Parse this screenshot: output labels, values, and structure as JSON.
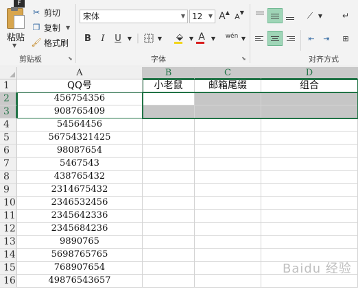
{
  "ribbon": {
    "file_tab": "F",
    "clipboard": {
      "paste_label": "粘贴",
      "cut_label": "剪切",
      "copy_label": "复制",
      "format_painter_label": "格式刷",
      "group_label": "剪贴板"
    },
    "font": {
      "font_name": "宋体",
      "font_size": "12",
      "grow_glyph": "A",
      "shrink_glyph": "A",
      "bold": "B",
      "italic": "I",
      "underline": "U",
      "font_color_glyph": "A",
      "wen_glyph": "wén",
      "fill_color": "#f2d51a",
      "font_color": "#d81e1e",
      "group_label": "字体"
    },
    "alignment": {
      "group_label": "对齐方式"
    }
  },
  "sheet": {
    "column_headers": [
      "A",
      "B",
      "C",
      "D"
    ],
    "row_numbers": [
      "1",
      "2",
      "3",
      "4",
      "5",
      "6",
      "7",
      "8",
      "9",
      "10",
      "11",
      "12",
      "13",
      "14",
      "15",
      "16"
    ],
    "header_row": [
      "QQ号",
      "小老鼠",
      "邮箱尾缀",
      "组合"
    ],
    "column_a_values": [
      "456754356",
      "908765409",
      "54564456",
      "56754321425",
      "98087654",
      "5467543",
      "438765432",
      "2314675432",
      "2346532456",
      "2345642336",
      "2345684236",
      "9890765",
      "5698765765",
      "768907654",
      "49876543657"
    ]
  },
  "watermark": "Baidu 经验",
  "colors": {
    "selection": "#217346",
    "selected_fill": "#c6c6c6",
    "align_active": "#9fd5b7"
  }
}
